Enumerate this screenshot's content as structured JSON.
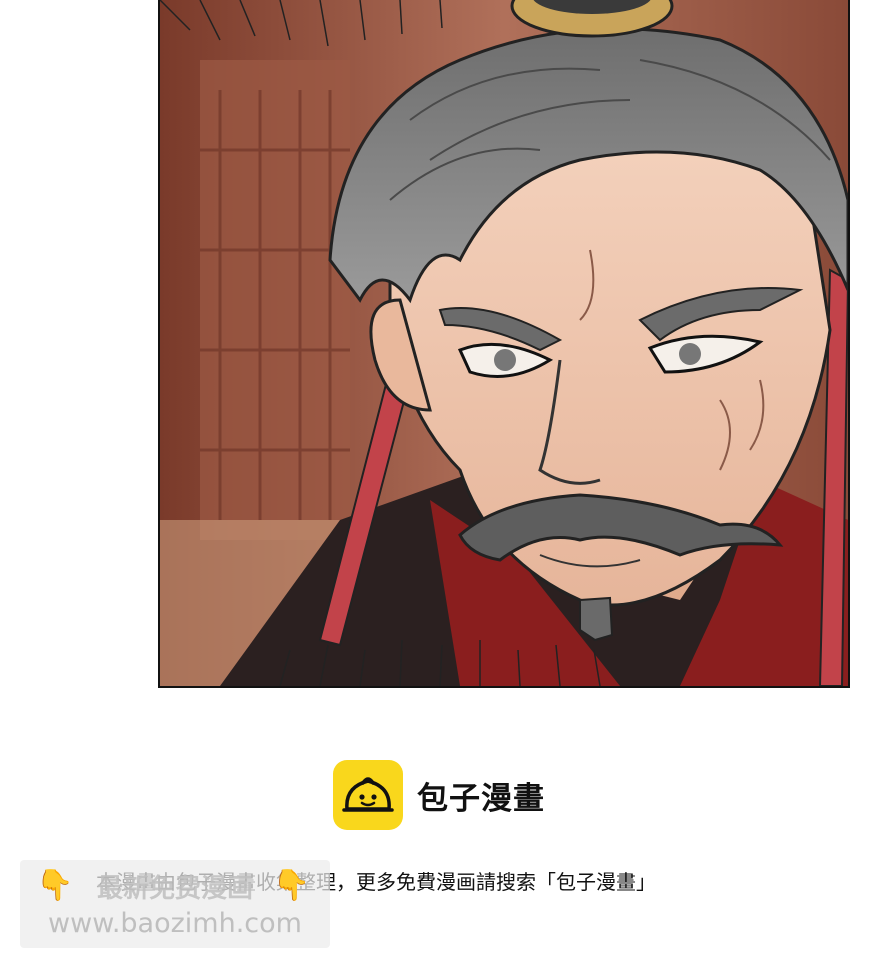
{
  "brand": {
    "name": "包子漫畫",
    "logo_icon": "bun-icon",
    "logo_color": "#f9d71c"
  },
  "credit_text": "本漫畫由包子漫畫收集整理，更多免費漫画請搜索「包子漫畫」",
  "watermark": {
    "line1": "最新免费漫画",
    "line2": "www.baozimh.com",
    "pointer_icon": "pointing-down-hand-icon"
  },
  "panel": {
    "description_icon": "comic-panel-image"
  }
}
